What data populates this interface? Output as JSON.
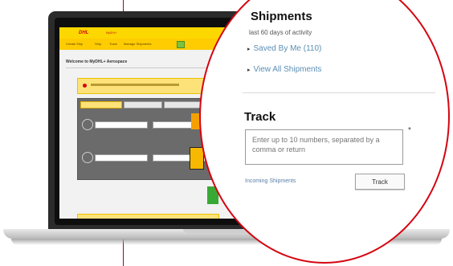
{
  "screen": {
    "logo": "DHL",
    "logo_tagline": "MyDHL+",
    "nav": [
      "Create Ship",
      "Ship",
      "Track",
      "Manage Shipments"
    ],
    "welcome": "Welcome to MyDHL+ Aerospace"
  },
  "magnifier": {
    "shipments_title": "Shipments",
    "activity_text": "last 60 days of activity",
    "links": [
      {
        "label": "Saved By Me (110)"
      },
      {
        "label": "View All Shipments"
      }
    ],
    "track_title": "Track",
    "track_placeholder": "Enter up to 10 numbers, separated by a comma or return",
    "required_mark": "*",
    "incoming_link": "Incoming Shipments",
    "track_button": "Track"
  },
  "colors": {
    "dhl_yellow": "#FFCC00",
    "dhl_red": "#D40511",
    "link_blue": "#5A8FB5"
  }
}
